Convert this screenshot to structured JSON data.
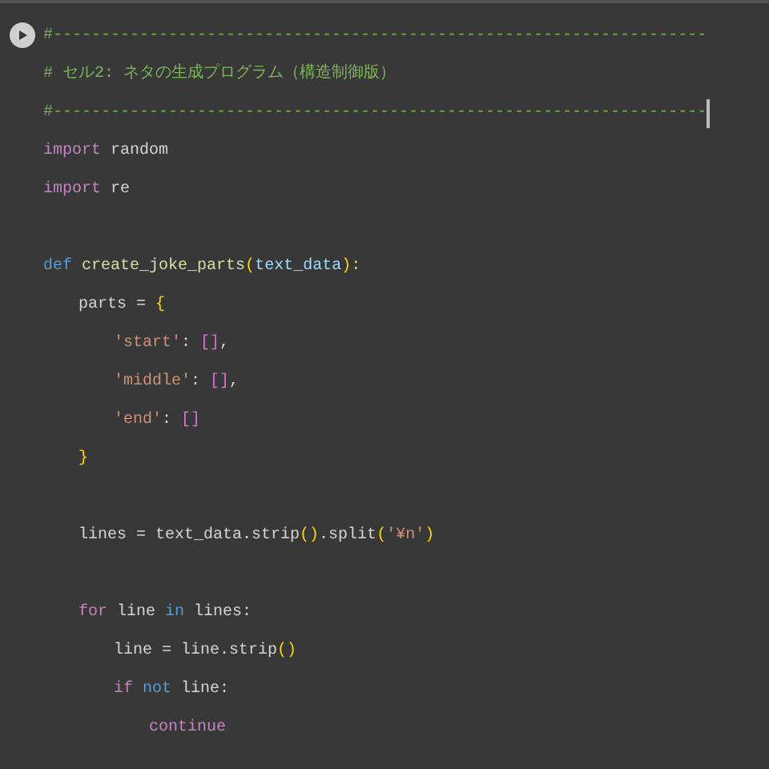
{
  "cell": {
    "run_button": {
      "kind": "run"
    },
    "lines": [
      {
        "tokens": [
          {
            "text": "#--------------------------------------------------------------------",
            "kind": "comment"
          }
        ]
      },
      {
        "tokens": [
          {
            "text": "# セル2: ネタの生成プログラム（構造制御版）",
            "kind": "comment"
          }
        ]
      },
      {
        "tokens": [
          {
            "text": "#--------------------------------------------------------------------",
            "kind": "comment"
          }
        ],
        "cursor": true
      },
      {
        "tokens": [
          {
            "text": "import",
            "kind": "keyword"
          },
          {
            "text": " random",
            "kind": "plain"
          }
        ]
      },
      {
        "tokens": [
          {
            "text": "import",
            "kind": "keyword"
          },
          {
            "text": " re",
            "kind": "plain"
          }
        ]
      },
      {
        "kind": "blank"
      },
      {
        "tokens": [
          {
            "text": "def",
            "kind": "def"
          },
          {
            "text": " create_joke_parts",
            "kind": "fn"
          },
          {
            "text": "(",
            "kind": "bracket"
          },
          {
            "text": "text_data",
            "kind": "param"
          },
          {
            "text": "):",
            "kind": "bracket"
          }
        ],
        "children": [
          {
            "tokens": [
              {
                "text": "parts = ",
                "kind": "plain"
              },
              {
                "text": "{",
                "kind": "bracket"
              }
            ],
            "children": [
              {
                "tokens": [
                  {
                    "text": "'start'",
                    "kind": "string"
                  },
                  {
                    "text": ": ",
                    "kind": "plain"
                  },
                  {
                    "text": "[]",
                    "kind": "bracket2"
                  },
                  {
                    "text": ",",
                    "kind": "plain"
                  }
                ]
              },
              {
                "tokens": [
                  {
                    "text": "'middle'",
                    "kind": "string"
                  },
                  {
                    "text": ": ",
                    "kind": "plain"
                  },
                  {
                    "text": "[]",
                    "kind": "bracket2"
                  },
                  {
                    "text": ",",
                    "kind": "plain"
                  }
                ]
              },
              {
                "tokens": [
                  {
                    "text": "'end'",
                    "kind": "string"
                  },
                  {
                    "text": ": ",
                    "kind": "plain"
                  },
                  {
                    "text": "[]",
                    "kind": "bracket2"
                  }
                ]
              }
            ]
          },
          {
            "tokens": [
              {
                "text": "}",
                "kind": "bracket"
              }
            ]
          },
          {
            "kind": "blank"
          },
          {
            "tokens": [
              {
                "text": "lines = text_data.strip",
                "kind": "plain"
              },
              {
                "text": "()",
                "kind": "bracket"
              },
              {
                "text": ".split",
                "kind": "plain"
              },
              {
                "text": "(",
                "kind": "bracket"
              },
              {
                "text": "'¥n'",
                "kind": "string"
              },
              {
                "text": ")",
                "kind": "bracket"
              }
            ]
          },
          {
            "kind": "blank"
          },
          {
            "tokens": [
              {
                "text": "for",
                "kind": "keyword"
              },
              {
                "text": " line ",
                "kind": "plain"
              },
              {
                "text": "in",
                "kind": "def"
              },
              {
                "text": " lines:",
                "kind": "plain"
              }
            ],
            "children": [
              {
                "tokens": [
                  {
                    "text": "line = line.strip",
                    "kind": "plain"
                  },
                  {
                    "text": "()",
                    "kind": "bracket"
                  }
                ]
              },
              {
                "tokens": [
                  {
                    "text": "if",
                    "kind": "keyword"
                  },
                  {
                    "text": " not",
                    "kind": "def"
                  },
                  {
                    "text": " line:",
                    "kind": "plain"
                  }
                ],
                "children": [
                  {
                    "tokens": [
                      {
                        "text": "continue",
                        "kind": "keyword"
                      }
                    ]
                  }
                ]
              }
            ]
          }
        ]
      }
    ]
  }
}
